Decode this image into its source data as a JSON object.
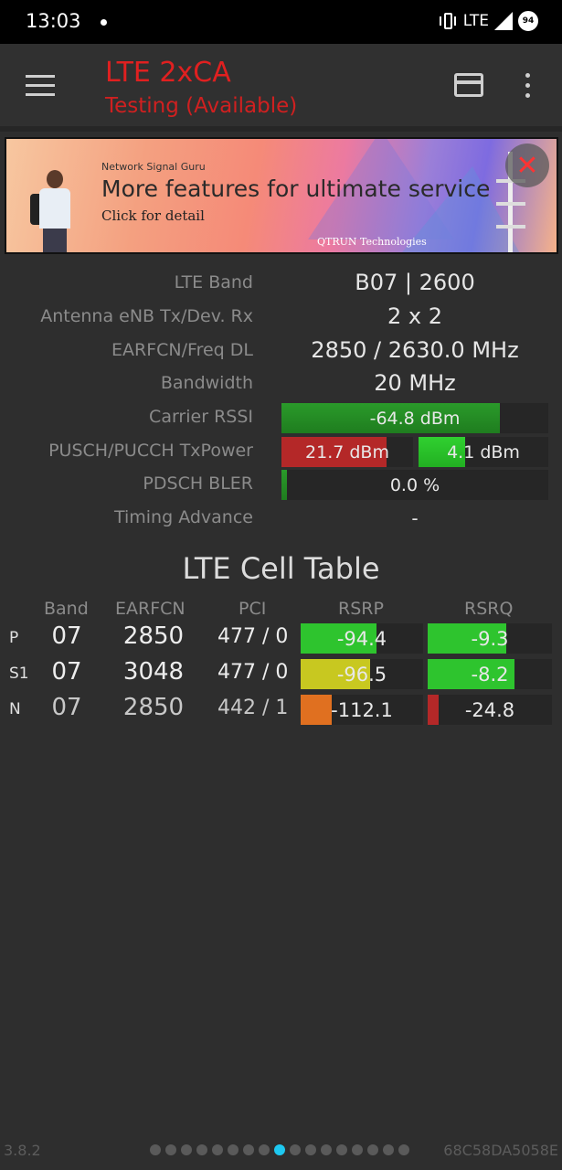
{
  "status": {
    "time": "13:03",
    "network": "LTE",
    "battery": "94"
  },
  "header": {
    "title": "LTE 2xCA",
    "subtitle": "Testing (Available)"
  },
  "ad": {
    "small": "Network Signal Guru",
    "main": "More features for ultimate service",
    "cta": "Click for detail",
    "brand": "QTRUN Technologies"
  },
  "info": {
    "lte_band": {
      "label": "LTE Band",
      "value": "B07 | 2600"
    },
    "antenna": {
      "label": "Antenna eNB Tx/Dev. Rx",
      "value": "2 x 2"
    },
    "earfcn": {
      "label": "EARFCN/Freq DL",
      "value": "2850 / 2630.0 MHz"
    },
    "bandwidth": {
      "label": "Bandwidth",
      "value": "20 MHz"
    },
    "rssi": {
      "label": "Carrier RSSI",
      "value": "-64.8 dBm",
      "fill": 0.82
    },
    "txpower": {
      "label": "PUSCH/PUCCH TxPower",
      "pusch": "21.7 dBm",
      "pusch_fill": 0.8,
      "pucch": "4.1 dBm",
      "pucch_fill": 0.36
    },
    "bler": {
      "label": "PDSCH BLER",
      "value": "0.0 %",
      "fill": 0.02
    },
    "timing": {
      "label": "Timing Advance",
      "value": "-"
    }
  },
  "cell_table": {
    "title": "LTE Cell Table",
    "headers": [
      "Band",
      "EARFCN",
      "PCI",
      "RSRP",
      "RSRQ"
    ],
    "rows": [
      {
        "label": "P",
        "band": "07",
        "earfcn": "2850",
        "pci": "477 / 0",
        "rsrp": "-94.4",
        "rsrp_fill": 0.62,
        "rsrp_color": "#2ec42e",
        "rsrq": "-9.3",
        "rsrq_fill": 0.63,
        "rsrq_color": "#2ec42e"
      },
      {
        "label": "S1",
        "band": "07",
        "earfcn": "3048",
        "pci": "477 / 0",
        "rsrp": "-96.5",
        "rsrp_fill": 0.57,
        "rsrp_color": "#c8c820",
        "rsrq": "-8.2",
        "rsrq_fill": 0.7,
        "rsrq_color": "#2ec42e"
      },
      {
        "label": "N",
        "band": "07",
        "earfcn": "2850",
        "pci": "442 / 1",
        "rsrp": "-112.1",
        "rsrp_fill": 0.25,
        "rsrp_color": "#e07020",
        "rsrq": "-24.8",
        "rsrq_fill": 0.09,
        "rsrq_color": "#b42828"
      }
    ]
  },
  "footer": {
    "version": "3.8.2",
    "device_id": "68C58DA5058E",
    "page_count": 17,
    "active_page": 8
  }
}
